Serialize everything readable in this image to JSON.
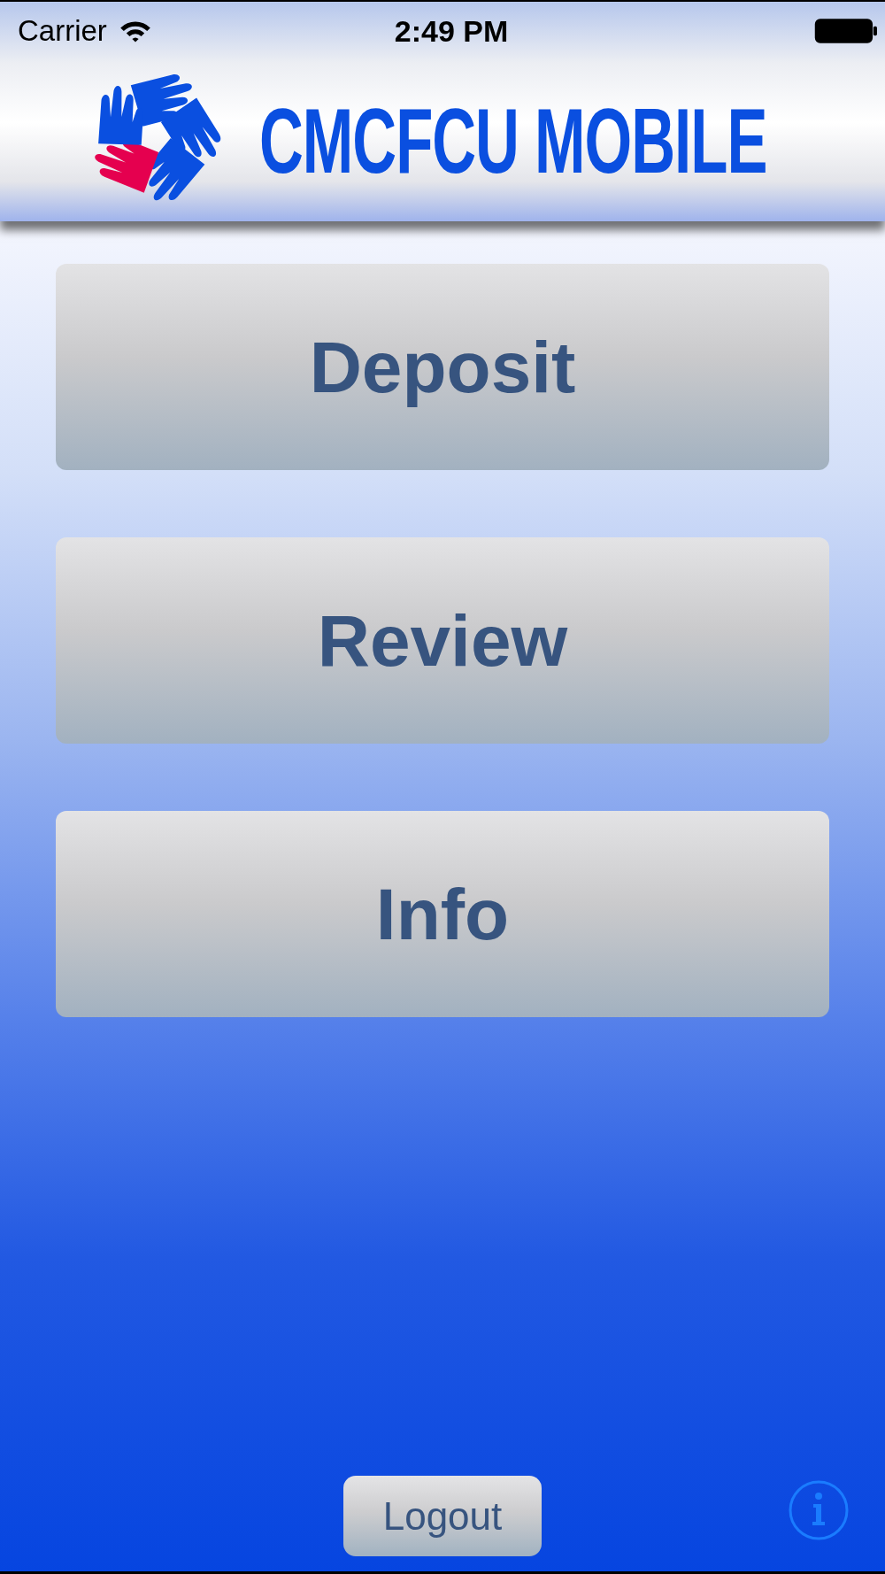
{
  "status_bar": {
    "carrier": "Carrier",
    "time": "2:49 PM"
  },
  "header": {
    "title": "CMCFCU MOBILE"
  },
  "menu_buttons": [
    "Deposit",
    "Review",
    "Info"
  ],
  "logout_button": "Logout"
}
